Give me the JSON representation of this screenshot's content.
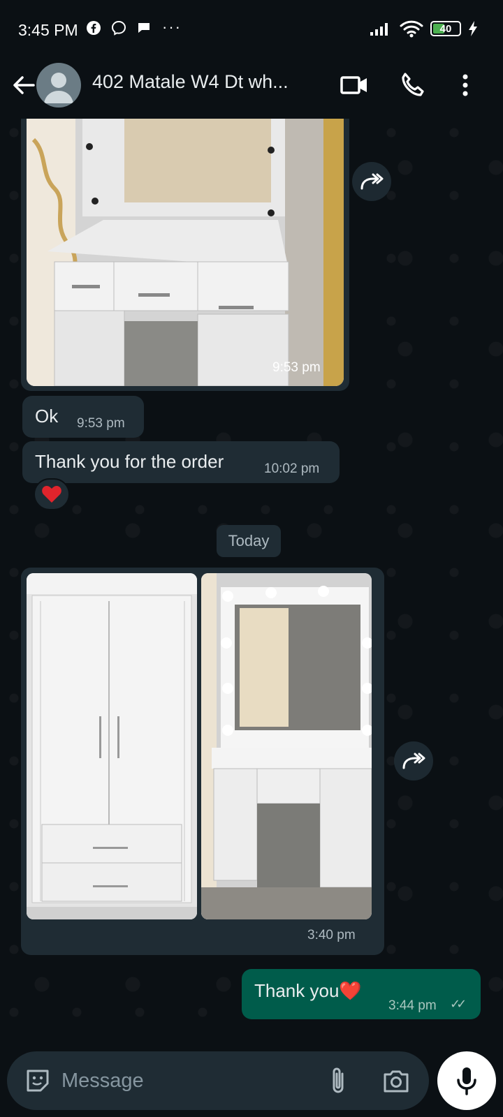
{
  "status_bar": {
    "time": "3:45 PM",
    "more": "···",
    "battery": "40"
  },
  "header": {
    "title": "402 Matale W4 Dt wh..."
  },
  "messages": [
    {
      "type": "image",
      "time": "9:53 pm"
    },
    {
      "type": "text",
      "text": "Ok",
      "time": "9:53 pm"
    },
    {
      "type": "text",
      "text": "Thank you for the order",
      "time": "10:02 pm",
      "reaction": "❤️"
    },
    {
      "type": "date",
      "text": "Today"
    },
    {
      "type": "album",
      "time": "3:40 pm"
    },
    {
      "type": "outgoing",
      "text": "Thank you❤️",
      "time": "3:44 pm",
      "ticks": "✓✓"
    }
  ],
  "input": {
    "placeholder": "Message"
  },
  "colors": {
    "background": "#0b1014",
    "incoming_bubble": "#1f2c34",
    "outgoing_bubble": "#005c4b",
    "text": "#e9edef",
    "meta": "#aebac1"
  }
}
